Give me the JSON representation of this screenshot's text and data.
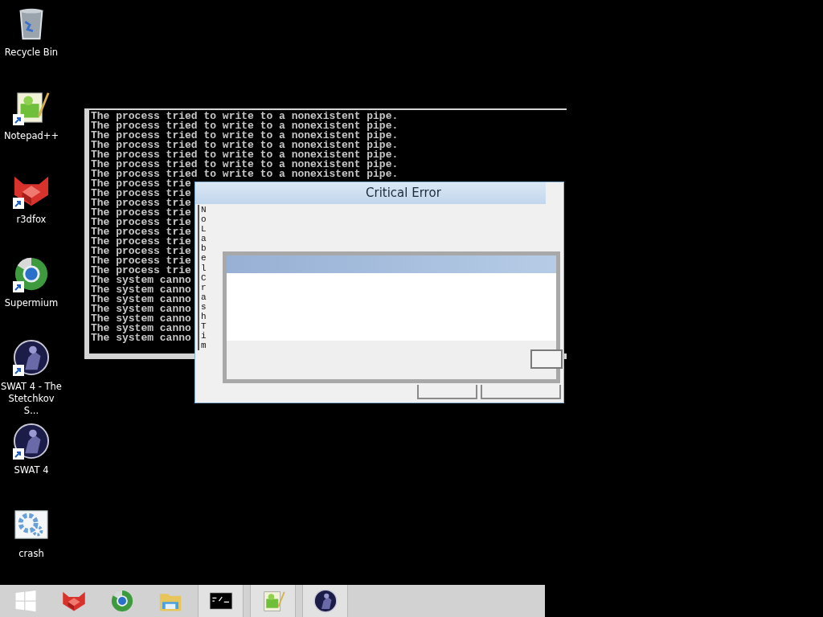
{
  "desktop_icons": [
    {
      "label": "Recycle Bin",
      "kind": "recycle-bin",
      "shortcut": false
    },
    {
      "label": "Notepad++",
      "kind": "notepad",
      "shortcut": true
    },
    {
      "label": "r3dfox",
      "kind": "fox",
      "shortcut": true
    },
    {
      "label": "Supermium",
      "kind": "globe",
      "shortcut": true
    },
    {
      "label": "SWAT 4 - The Stetchkov S...",
      "kind": "swat",
      "shortcut": true
    },
    {
      "label": "SWAT 4",
      "kind": "swat",
      "shortcut": true
    },
    {
      "label": "crash",
      "kind": "gear",
      "shortcut": false
    }
  ],
  "console": {
    "lines": [
      "The process tried to write to a nonexistent pipe.",
      "The process tried to write to a nonexistent pipe.",
      "The process tried to write to a nonexistent pipe.",
      "The process tried to write to a nonexistent pipe.",
      "The process tried to write to a nonexistent pipe.",
      "The process tried to write to a nonexistent pipe.",
      "The process tried to write to a nonexistent pipe.",
      "The process trie",
      "The process trie",
      "The process trie",
      "The process trie",
      "The process trie",
      "The process trie",
      "The process trie",
      "The process trie",
      "The process trie",
      "The process trie",
      "The system canno",
      "The system canno",
      "The system canno",
      "The system canno",
      "The system canno",
      "The system canno",
      "The system canno"
    ]
  },
  "dialog": {
    "title": "Critical Error",
    "vertical_label": "NoLabel CrashTim"
  },
  "taskbar": {
    "items": [
      {
        "kind": "start",
        "running": false
      },
      {
        "kind": "fox",
        "running": false
      },
      {
        "kind": "globe",
        "running": false
      },
      {
        "kind": "folder",
        "running": false
      },
      {
        "kind": "console",
        "running": true
      },
      {
        "kind": "notepad",
        "running": true
      },
      {
        "kind": "swat",
        "running": true
      }
    ]
  }
}
